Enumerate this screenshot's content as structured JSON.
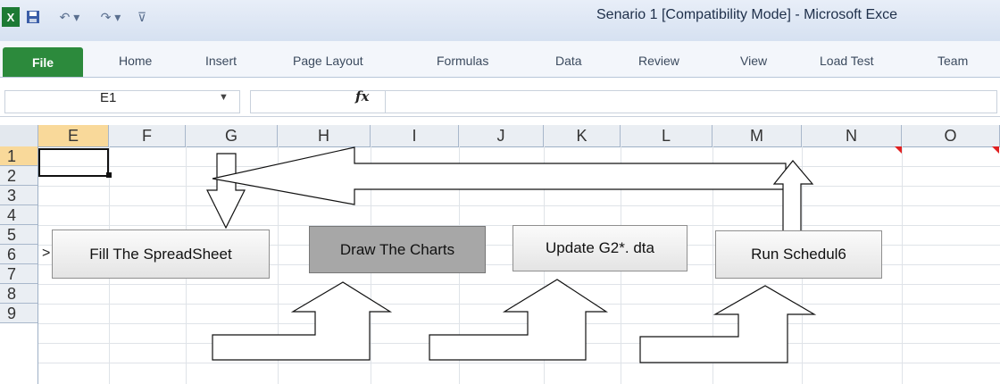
{
  "window": {
    "title": "Senario 1  [Compatibility Mode]  -  Microsoft Exce",
    "app_icon": "excel-icon",
    "quick_access": [
      "save-icon",
      "undo-icon",
      "redo-icon",
      "customize-icon"
    ]
  },
  "ribbon": {
    "file_label": "File",
    "tabs": [
      "Home",
      "Insert",
      "Page Layout",
      "Formulas",
      "Data",
      "Review",
      "View",
      "Load Test",
      "Team"
    ]
  },
  "formula_bar": {
    "name_box_value": "E1",
    "fx_label": "fx",
    "formula_value": ""
  },
  "grid": {
    "columns": [
      "E",
      "F",
      "G",
      "H",
      "I",
      "J",
      "K",
      "L",
      "M",
      "N",
      "O"
    ],
    "rows": [
      "1",
      "2",
      "3",
      "4",
      "5",
      "6",
      "7",
      "8",
      "9"
    ],
    "selected_cell": "E1",
    "selected_column": "E",
    "selected_row": "1"
  },
  "buttons": {
    "fill": "Fill The SpreadSheet",
    "draw": "Draw The  Charts",
    "update": "Update G2*. dta",
    "run": "Run Schedul6"
  },
  "marker_text": ">",
  "colors": {
    "file_tab": "#2c8a3c",
    "selected_header": "#f9d99a",
    "comment_indicator": "#e02020",
    "pressed_button": "#a7a7a7"
  }
}
